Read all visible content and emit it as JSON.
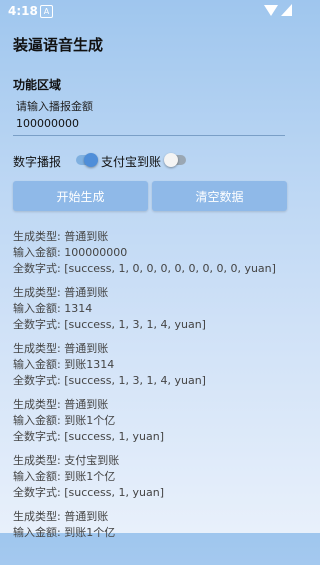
{
  "status": {
    "time": "4:18",
    "app_icon": "A"
  },
  "app": {
    "title": "装逼语音生成"
  },
  "section": {
    "title": "功能区域"
  },
  "amount": {
    "label": "请输入播报金额",
    "value": "100000000"
  },
  "toggles": [
    {
      "label": "数字播报",
      "checked": true
    },
    {
      "label": "支付宝到账",
      "checked": false
    }
  ],
  "buttons": {
    "generate": "开始生成",
    "clear": "清空数据"
  },
  "log": [
    {
      "type": "生成类型: 普通到账",
      "amount": "输入金额: 100000000",
      "text": "全数字式: [success, 1, 0, 0, 0, 0, 0, 0, 0, 0, yuan]"
    },
    {
      "type": "生成类型: 普通到账",
      "amount": "输入金额: 1314",
      "text": "全数字式: [success, 1, 3, 1, 4, yuan]"
    },
    {
      "type": "生成类型: 普通到账",
      "amount": "输入金额: 到账1314",
      "text": "全数字式: [success, 1, 3, 1, 4, yuan]"
    },
    {
      "type": "生成类型: 普通到账",
      "amount": "输入金额: 到账1个亿",
      "text": "全数字式: [success, 1, yuan]"
    },
    {
      "type": "生成类型: 支付宝到账",
      "amount": "输入金额: 到账1个亿",
      "text": "全数字式: [success, 1, yuan]"
    },
    {
      "type": "生成类型: 普通到账",
      "amount": "输入金额: 到账1个亿",
      "text": ""
    }
  ]
}
